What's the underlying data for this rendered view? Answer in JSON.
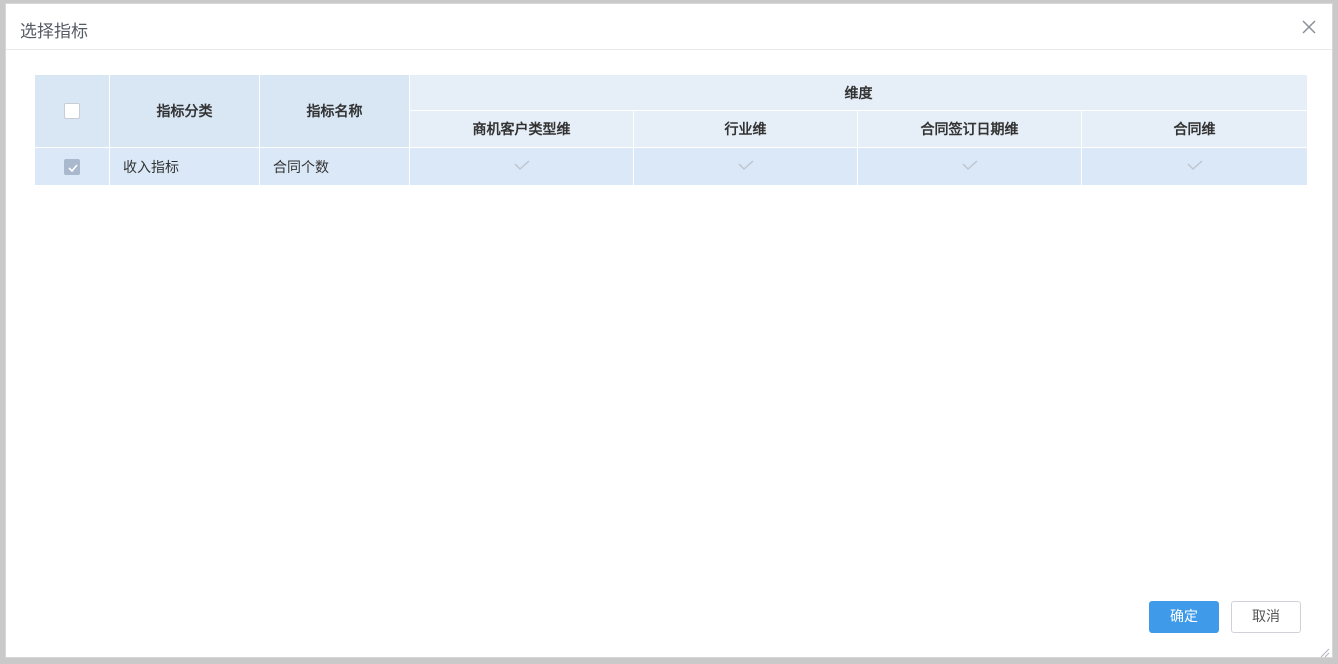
{
  "dialog": {
    "title": "选择指标",
    "close_icon": "close-icon"
  },
  "table": {
    "headers": {
      "category": "指标分类",
      "name": "指标名称",
      "dimension_group": "维度",
      "dimensions": [
        "商机客户类型维",
        "行业维",
        "合同签订日期维",
        "合同维"
      ]
    },
    "select_all_checked": false,
    "rows": [
      {
        "checked": true,
        "category": "收入指标",
        "name": "合同个数",
        "dimensions": [
          "check-icon",
          "check-icon",
          "check-icon",
          "check-icon"
        ]
      }
    ]
  },
  "buttons": {
    "ok": "确定",
    "cancel": "取消"
  },
  "colors": {
    "primary": "#3f9be9",
    "header_bg": "#e6eef7",
    "selected_row_bg": "#dae8f7"
  }
}
